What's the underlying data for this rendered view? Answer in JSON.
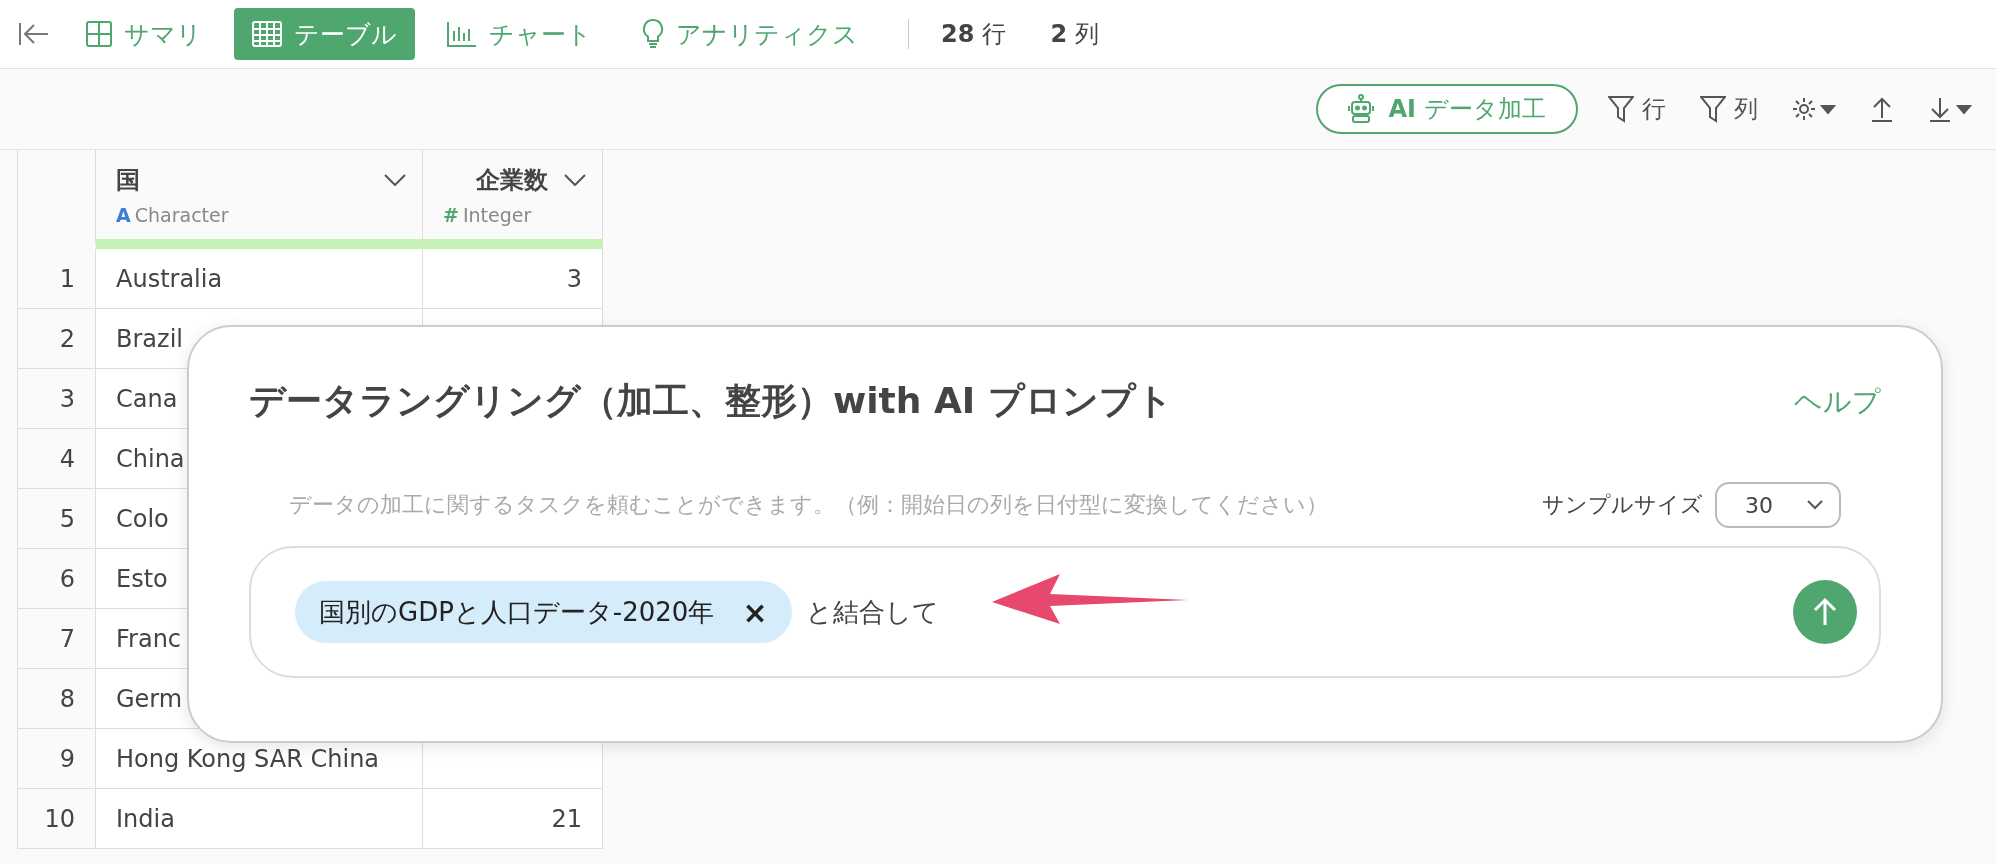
{
  "nav": {
    "tabs": [
      {
        "label": "サマリ",
        "selected": false
      },
      {
        "label": "テーブル",
        "selected": true
      },
      {
        "label": "チャート",
        "selected": false
      },
      {
        "label": "アナリティクス",
        "selected": false
      }
    ],
    "stats": [
      {
        "value": "28",
        "unit": "行"
      },
      {
        "value": "2",
        "unit": "列"
      }
    ]
  },
  "toolbar": {
    "ai_button": {
      "prefix": "AI",
      "label": "データ加工"
    },
    "row_filter": "行",
    "column_filter": "列"
  },
  "table": {
    "columns": [
      {
        "name": "国",
        "type_mark": "A",
        "type": "Character"
      },
      {
        "name": "企業数",
        "type_mark": "#",
        "type": "Integer"
      }
    ],
    "rows": [
      {
        "index": "1",
        "cells": [
          "Australia",
          "3"
        ]
      },
      {
        "index": "2",
        "cells": [
          "Brazil"
        ]
      },
      {
        "index": "3",
        "cells": [
          "Cana"
        ]
      },
      {
        "index": "4",
        "cells": [
          "China"
        ]
      },
      {
        "index": "5",
        "cells": [
          "Colo"
        ]
      },
      {
        "index": "6",
        "cells": [
          "Esto"
        ]
      },
      {
        "index": "7",
        "cells": [
          "Franc"
        ]
      },
      {
        "index": "8",
        "cells": [
          "Germ"
        ]
      },
      {
        "index": "9",
        "cells": [
          "Hong Kong SAR China"
        ]
      },
      {
        "index": "10",
        "cells": [
          "India",
          "21"
        ]
      }
    ]
  },
  "dialog": {
    "title": "データラングリング（加工、整形）with AI プロンプト",
    "help": "ヘルプ",
    "hint": "データの加工に関するタスクを頼むことができます。（例：開始日の列を日付型に変換してください）",
    "sample_label": "サンプルサイズ",
    "sample_value": "30",
    "chip": "国別のGDPと人口データ-2020年",
    "chip_remove": "×",
    "prompt_text": "と結合して"
  }
}
